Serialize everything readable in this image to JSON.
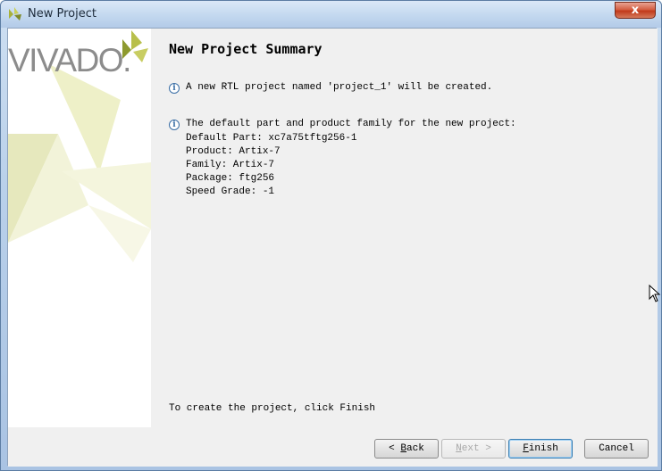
{
  "window": {
    "title": "New Project",
    "close_label": "x"
  },
  "sidebar": {
    "logo_text": "VIVADO."
  },
  "main": {
    "heading": "New Project Summary",
    "info1": "A new RTL project named 'project_1' will be created.",
    "info2": "The default part and product family for the new project:",
    "details": [
      "Default Part: xc7a75tftg256-1",
      "Product: Artix-7",
      "Family: Artix-7",
      "Package: ftg256",
      "Speed Grade: -1"
    ],
    "footer": "To create the project, click Finish"
  },
  "buttons": {
    "back": {
      "arrow": "<",
      "mnemonic": "B",
      "rest": "ack"
    },
    "next": {
      "mnemonic": "N",
      "rest": "ext",
      "arrow": ">"
    },
    "finish": {
      "mnemonic": "F",
      "rest": "inish"
    },
    "cancel": "Cancel"
  },
  "colors": {
    "accent_yellow": "#e7e8a8",
    "logo_green": "#9aa63a",
    "title_blue": "#c3d8ef"
  }
}
